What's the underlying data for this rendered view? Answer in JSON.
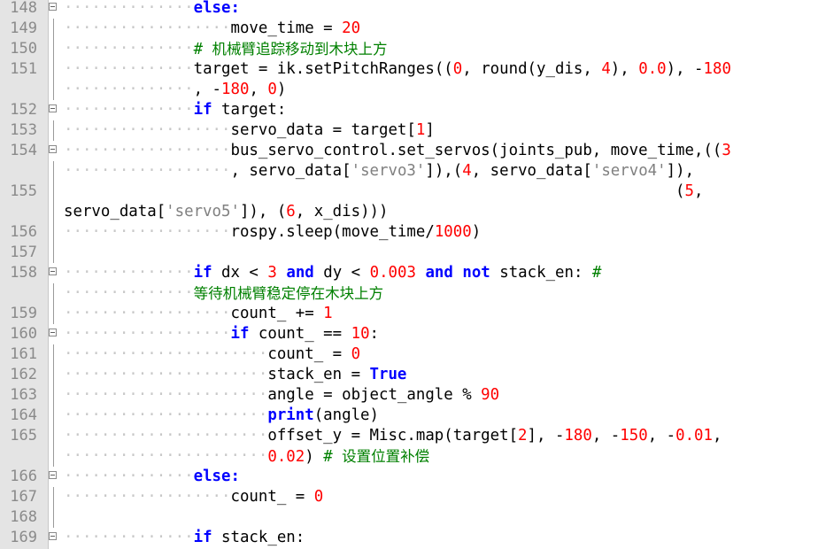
{
  "editor": {
    "colors": {
      "keyword": "#0000ff",
      "number": "#ff0000",
      "string": "#808080",
      "comment": "#008000",
      "text": "#000000",
      "gutter": "#e4e4e4",
      "line_number": "#8a8a8a"
    },
    "lines": [
      {
        "num": "148",
        "fold": true,
        "lead": "              ",
        "segs": [
          [
            "kw",
            "else:"
          ]
        ]
      },
      {
        "num": "149",
        "lead": "                  ",
        "segs": [
          [
            "t",
            "move_time = "
          ],
          [
            "num",
            "20"
          ]
        ]
      },
      {
        "num": "150",
        "lead": "              ",
        "segs": [
          [
            "cmt",
            "# "
          ],
          [
            "cmtc",
            "机械臂追踪移动到木块上方"
          ]
        ]
      },
      {
        "num": "151",
        "lead": "              ",
        "segs": [
          [
            "t",
            "target = ik.setPitchRanges(("
          ],
          [
            "num",
            "0"
          ],
          [
            "t",
            ", round(y_dis, "
          ],
          [
            "num",
            "4"
          ],
          [
            "t",
            "), "
          ],
          [
            "num",
            "0.0"
          ],
          [
            "t",
            "), -"
          ],
          [
            "num",
            "180"
          ]
        ]
      },
      {
        "num": "",
        "lead": "              ",
        "segs": [
          [
            "t",
            ", -"
          ],
          [
            "num",
            "180"
          ],
          [
            "t",
            ", "
          ],
          [
            "num",
            "0"
          ],
          [
            "t",
            ")"
          ]
        ]
      },
      {
        "num": "152",
        "fold": true,
        "lead": "              ",
        "segs": [
          [
            "kw",
            "if"
          ],
          [
            "t",
            " target:"
          ]
        ]
      },
      {
        "num": "153",
        "lead": "                  ",
        "segs": [
          [
            "t",
            "servo_data = target["
          ],
          [
            "num",
            "1"
          ],
          [
            "t",
            "]"
          ]
        ]
      },
      {
        "num": "154",
        "fold": true,
        "lead": "                  ",
        "segs": [
          [
            "t",
            "bus_servo_control.set_servos(joints_pub, move_time,(("
          ],
          [
            "num",
            "3"
          ]
        ]
      },
      {
        "num": "",
        "lead": "                  ",
        "segs": [
          [
            "t",
            ", servo_data["
          ],
          [
            "str",
            "'servo3'"
          ],
          [
            "t",
            "]),("
          ],
          [
            "num",
            "4"
          ],
          [
            "t",
            ", servo_data["
          ],
          [
            "str",
            "'servo4'"
          ],
          [
            "t",
            "]),"
          ]
        ]
      },
      {
        "num": "155",
        "lead": "",
        "segs": [
          [
            "t",
            "                                                                  ("
          ],
          [
            "num",
            "5"
          ],
          [
            "t",
            ","
          ]
        ]
      },
      {
        "num": "",
        "lead": "",
        "segs": [
          [
            "t",
            "servo_data["
          ],
          [
            "str",
            "'servo5'"
          ],
          [
            "t",
            "]), ("
          ],
          [
            "num",
            "6"
          ],
          [
            "t",
            ", x_dis)))"
          ]
        ]
      },
      {
        "num": "156",
        "lead": "                  ",
        "segs": [
          [
            "t",
            "rospy.sleep(move_time/"
          ],
          [
            "num",
            "1000"
          ],
          [
            "t",
            ")"
          ]
        ]
      },
      {
        "num": "157",
        "lead": "",
        "segs": []
      },
      {
        "num": "158",
        "fold": true,
        "lead": "              ",
        "segs": [
          [
            "kw",
            "if"
          ],
          [
            "t",
            " dx < "
          ],
          [
            "num",
            "3"
          ],
          [
            "t",
            " "
          ],
          [
            "kw",
            "and"
          ],
          [
            "t",
            " dy < "
          ],
          [
            "num",
            "0.003"
          ],
          [
            "t",
            " "
          ],
          [
            "kw",
            "and"
          ],
          [
            "t",
            " "
          ],
          [
            "kw",
            "not"
          ],
          [
            "t",
            " stack_en: "
          ],
          [
            "cmt",
            "#"
          ]
        ]
      },
      {
        "num": "",
        "lead": "              ",
        "segs": [
          [
            "cmtc",
            "等待机械臂稳定停在木块上方"
          ]
        ]
      },
      {
        "num": "159",
        "lead": "                  ",
        "segs": [
          [
            "t",
            "count_ += "
          ],
          [
            "num",
            "1"
          ]
        ]
      },
      {
        "num": "160",
        "fold": true,
        "lead": "                  ",
        "segs": [
          [
            "kw",
            "if"
          ],
          [
            "t",
            " count_ == "
          ],
          [
            "num",
            "10"
          ],
          [
            "t",
            ":"
          ]
        ]
      },
      {
        "num": "161",
        "lead": "                      ",
        "segs": [
          [
            "t",
            "count_ = "
          ],
          [
            "num",
            "0"
          ]
        ]
      },
      {
        "num": "162",
        "lead": "                      ",
        "segs": [
          [
            "t",
            "stack_en = "
          ],
          [
            "kw",
            "True"
          ]
        ]
      },
      {
        "num": "163",
        "lead": "                      ",
        "segs": [
          [
            "t",
            "angle = object_angle % "
          ],
          [
            "num",
            "90"
          ]
        ]
      },
      {
        "num": "164",
        "lead": "                      ",
        "segs": [
          [
            "kw",
            "print"
          ],
          [
            "t",
            "(angle)"
          ]
        ]
      },
      {
        "num": "165",
        "lead": "                      ",
        "segs": [
          [
            "t",
            "offset_y = Misc.map(target["
          ],
          [
            "num",
            "2"
          ],
          [
            "t",
            "], -"
          ],
          [
            "num",
            "180"
          ],
          [
            "t",
            ", -"
          ],
          [
            "num",
            "150"
          ],
          [
            "t",
            ", -"
          ],
          [
            "num",
            "0.01"
          ],
          [
            "t",
            ","
          ]
        ]
      },
      {
        "num": "",
        "lead": "                      ",
        "segs": [
          [
            "num",
            "0.02"
          ],
          [
            "t",
            ") "
          ],
          [
            "cmt",
            "# "
          ],
          [
            "cmtc",
            "设置位置补偿"
          ]
        ]
      },
      {
        "num": "166",
        "fold": true,
        "lead": "              ",
        "segs": [
          [
            "kw",
            "else:"
          ]
        ]
      },
      {
        "num": "167",
        "lead": "                  ",
        "segs": [
          [
            "t",
            "count_ = "
          ],
          [
            "num",
            "0"
          ]
        ]
      },
      {
        "num": "168",
        "lead": "",
        "segs": []
      },
      {
        "num": "169",
        "fold": true,
        "lead": "              ",
        "segs": [
          [
            "kw",
            "if"
          ],
          [
            "t",
            " stack_en:"
          ]
        ]
      }
    ]
  }
}
